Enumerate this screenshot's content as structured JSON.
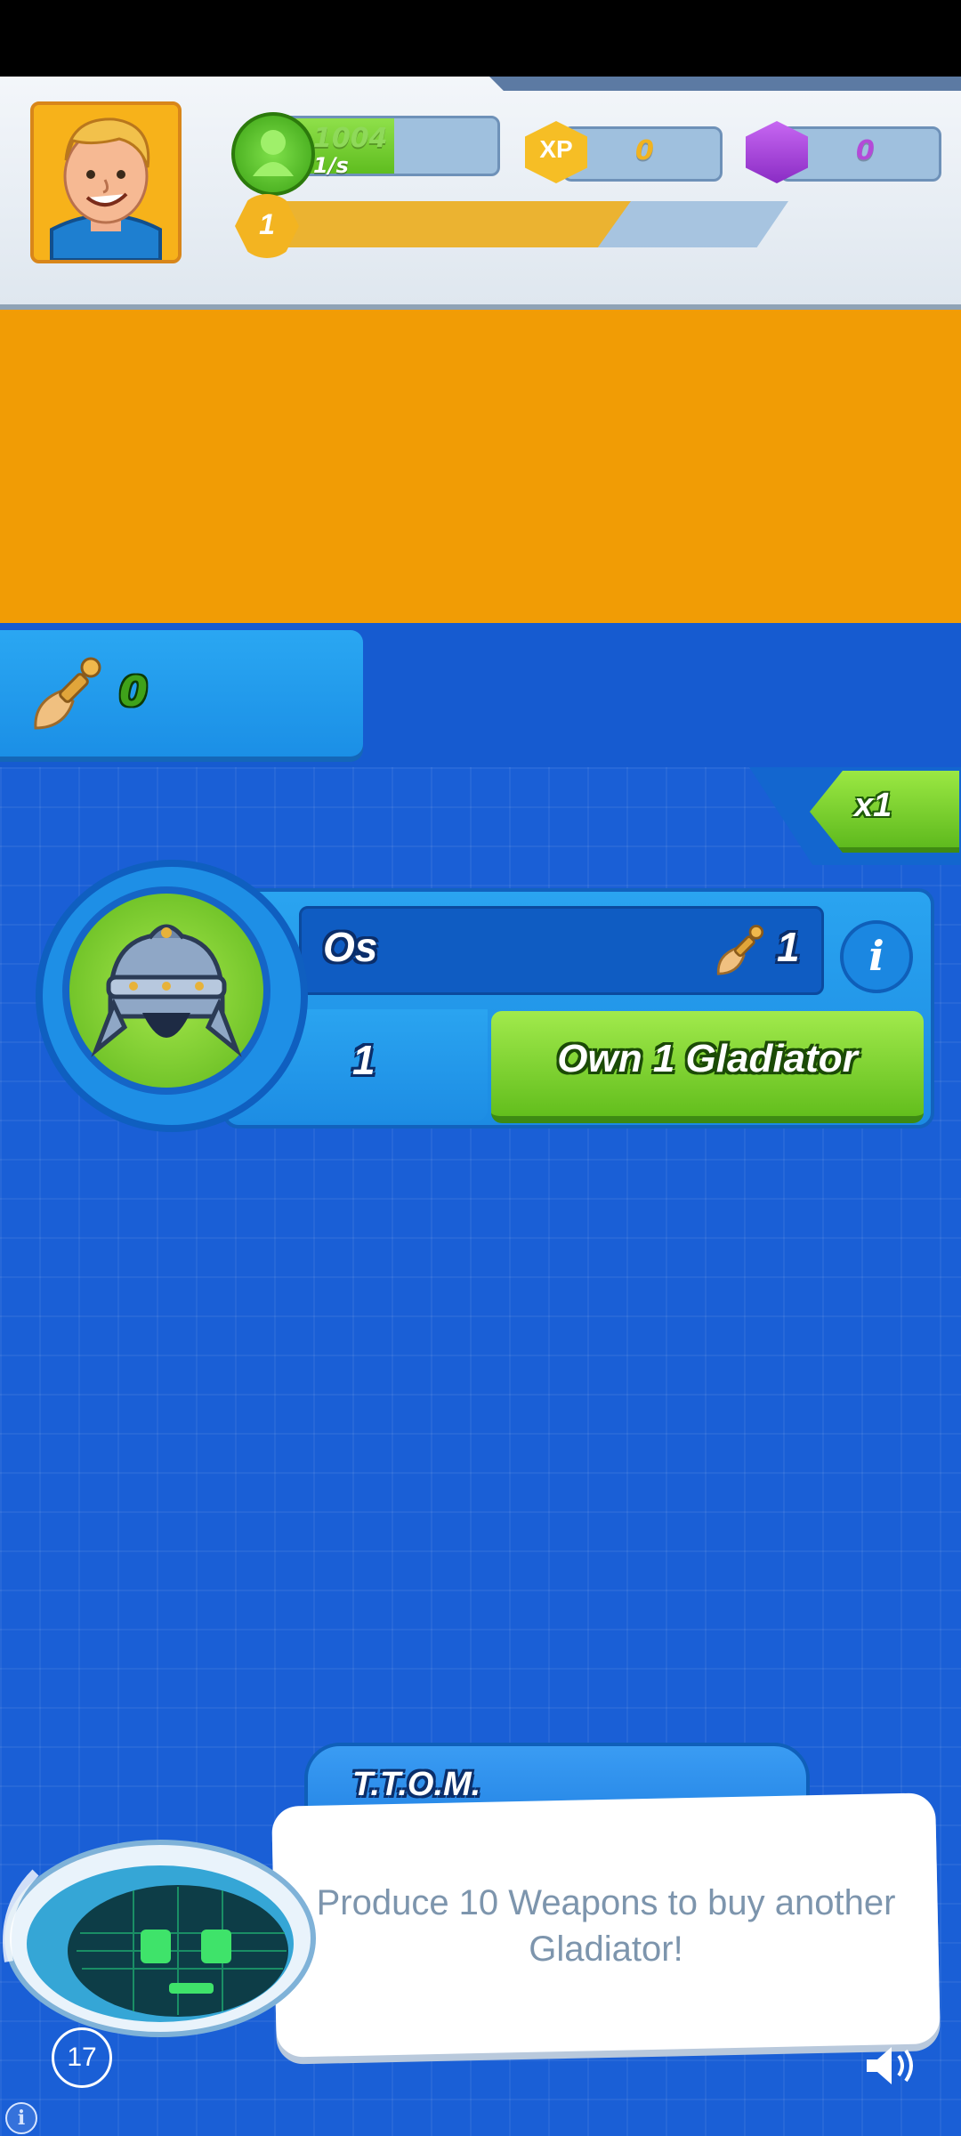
{
  "header": {
    "cash_value": "1004",
    "cash_rate": "1/s",
    "xp_icon_label": "XP",
    "xp_value": "0",
    "gems_value": "0",
    "level": "1",
    "level_progress_fraction": 0.7
  },
  "weapons": {
    "count": "0"
  },
  "multiplier": {
    "label": "x1"
  },
  "unit_card": {
    "name": "Os",
    "cost": "1",
    "owned_count": "1",
    "action_label": "Own 1 Gladiator"
  },
  "advisor": {
    "name": "T.T.O.M.",
    "message": "Produce 10 Weapons to buy another Gladiator!",
    "timer": "17"
  },
  "colors": {
    "cash": "#5fbd1f",
    "xp": "#f2b51a",
    "gem": "#a33fd6",
    "background": "#1a5fd6",
    "banner": "#f19c05"
  }
}
